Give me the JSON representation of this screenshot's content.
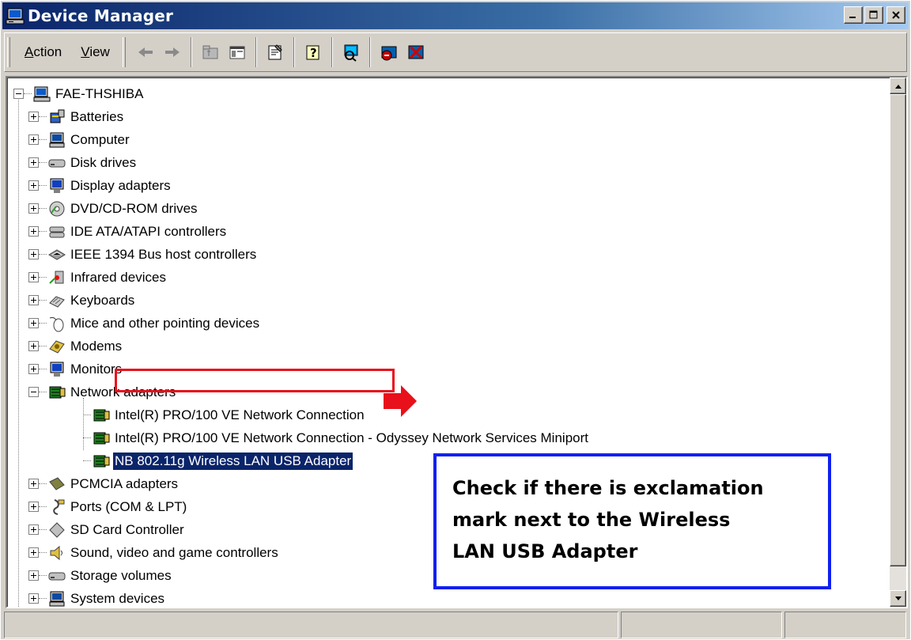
{
  "window": {
    "title": "Device Manager"
  },
  "menu": {
    "action": {
      "first": "A",
      "rest": "ction"
    },
    "view": {
      "first": "V",
      "rest": "iew"
    }
  },
  "toolbar_icons": [
    "back-arrow-icon",
    "forward-arrow-icon",
    "up-folder-icon",
    "show-hide-tree-icon",
    "properties-icon",
    "help-icon",
    "scan-hardware-icon",
    "uninstall-device-icon",
    "disable-device-icon"
  ],
  "tree": {
    "root": "FAE-THSHIBA",
    "categories": [
      {
        "label": "Batteries",
        "icon": "battery-icon"
      },
      {
        "label": "Computer",
        "icon": "computer-icon"
      },
      {
        "label": "Disk drives",
        "icon": "disk-drive-icon"
      },
      {
        "label": "Display adapters",
        "icon": "display-icon"
      },
      {
        "label": "DVD/CD-ROM drives",
        "icon": "cdrom-icon"
      },
      {
        "label": "IDE ATA/ATAPI controllers",
        "icon": "ide-controller-icon"
      },
      {
        "label": "IEEE 1394 Bus host controllers",
        "icon": "ieee1394-icon"
      },
      {
        "label": "Infrared devices",
        "icon": "infrared-icon"
      },
      {
        "label": "Keyboards",
        "icon": "keyboard-icon"
      },
      {
        "label": "Mice and other pointing devices",
        "icon": "mouse-icon"
      },
      {
        "label": "Modems",
        "icon": "modem-icon"
      },
      {
        "label": "Monitors",
        "icon": "monitor-icon"
      },
      {
        "label": "Network adapters",
        "icon": "network-adapter-icon",
        "expanded": true
      },
      {
        "label": "PCMCIA adapters",
        "icon": "pcmcia-icon"
      },
      {
        "label": "Ports (COM & LPT)",
        "icon": "port-icon"
      },
      {
        "label": "SD Card Controller",
        "icon": "sd-card-icon"
      },
      {
        "label": "Sound, video and game controllers",
        "icon": "sound-icon"
      },
      {
        "label": "Storage volumes",
        "icon": "storage-icon"
      },
      {
        "label": "System devices",
        "icon": "system-device-icon"
      }
    ],
    "network_children": [
      "Intel(R) PRO/100 VE Network Connection",
      "Intel(R) PRO/100 VE Network Connection - Odyssey Network Services Miniport",
      "NB 802.11g Wireless LAN USB Adapter"
    ],
    "selected": "NB 802.11g Wireless LAN USB Adapter"
  },
  "callout": {
    "text": "Check if there is exclamation\nmark next to the Wireless\nLAN USB Adapter",
    "border_color": "#1020f0"
  },
  "highlight_color": "#e8101a",
  "selection_color": "#0a246a"
}
